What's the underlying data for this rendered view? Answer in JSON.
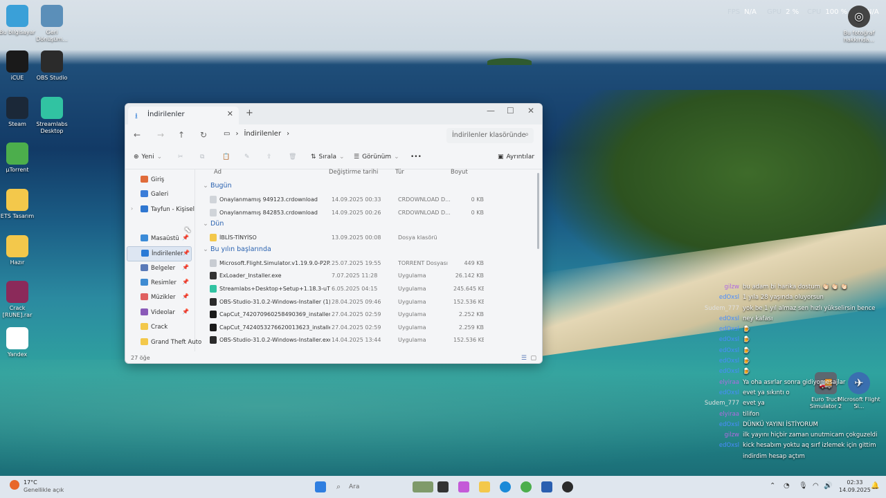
{
  "desktop": {
    "icons_left": [
      {
        "label": "Bu bilgisayar",
        "icon": "computer-icon",
        "color": "#3aa0d8"
      },
      {
        "label": "Geri Dönüşüm...",
        "icon": "recycle-bin-icon",
        "color": "#5b8fb9"
      },
      {
        "label": "iCUE",
        "icon": "icue-icon",
        "color": "#1a1a1a"
      },
      {
        "label": "OBS Studio",
        "icon": "obs-icon",
        "color": "#2b2b2b"
      },
      {
        "label": "Steam",
        "icon": "steam-icon",
        "color": "#1b2838"
      },
      {
        "label": "Streamlabs Desktop",
        "icon": "streamlabs-icon",
        "color": "#31c3a2"
      },
      {
        "label": "µTorrent",
        "icon": "utorrent-icon",
        "color": "#4cae4c"
      },
      {
        "label": "ETS Tasarım",
        "icon": "folder-icon",
        "color": "#f3c84b"
      },
      {
        "label": "Hazır",
        "icon": "folder-icon",
        "color": "#f3c84b"
      },
      {
        "label": "Crack [RUNE].rar",
        "icon": "winrar-icon",
        "color": "#8b2a5a"
      },
      {
        "label": "Yandex",
        "icon": "yandex-icon",
        "color": "#ffffff"
      }
    ],
    "icons_right": [
      {
        "label": "Bu fotoğraf hakkında...",
        "icon": "camera-info-icon"
      },
      {
        "label": "Euro Truck Simulator 2",
        "icon": "ets2-icon"
      },
      {
        "label": "Microsoft Flight Si...",
        "icon": "flight-simulator-icon"
      }
    ],
    "overlay_stats": {
      "fps_label": "FPS",
      "fps_value": "N/A",
      "gpu_label": "GPU",
      "gpu_value": "2 %",
      "cpu_label": "CPU",
      "cpu_value": "100 %",
      "extra_value": "N/A"
    }
  },
  "explorer": {
    "tab_title": "İndirilenler",
    "breadcrumb": [
      "İndirilenler"
    ],
    "search_placeholder": "İndirilenler klasöründe",
    "commands": {
      "new": "Yeni",
      "sort": "Sırala",
      "view": "Görünüm",
      "more": "•••",
      "details": "Ayrıntılar"
    },
    "sidebar": [
      {
        "label": "Giriş",
        "icon": "home-icon",
        "color": "#e06b3a"
      },
      {
        "label": "Galeri",
        "icon": "gallery-icon",
        "color": "#3b7dd8"
      },
      {
        "label": "Tayfun - Kişisel",
        "icon": "onedrive-icon",
        "color": "#2f77d1"
      },
      {
        "label": "Masaüstü",
        "icon": "desktop-icon",
        "color": "#3b8bd8"
      },
      {
        "label": "İndirilenler",
        "icon": "downloads-icon",
        "color": "#2a7ad6"
      },
      {
        "label": "Belgeler",
        "icon": "documents-icon",
        "color": "#5a7ab8"
      },
      {
        "label": "Resimler",
        "icon": "pictures-icon",
        "color": "#3f8bd2"
      },
      {
        "label": "Müzikler",
        "icon": "music-icon",
        "color": "#e06060"
      },
      {
        "label": "Videolar",
        "icon": "videos-icon",
        "color": "#8a5ab8"
      },
      {
        "label": "Crack",
        "icon": "folder-icon",
        "color": "#f3c84b"
      },
      {
        "label": "Grand Theft Auto",
        "icon": "folder-icon",
        "color": "#f3c84b"
      }
    ],
    "columns": {
      "name": "Ad",
      "date": "Değiştirme tarihi",
      "type": "Tür",
      "size": "Boyut"
    },
    "groups": [
      {
        "title": "Bugün",
        "rows": [
          {
            "name": "Onaylanmamış 949123.crdownload",
            "date": "14.09.2025 00:33",
            "type": "CRDOWNLOAD D...",
            "size": "0 KB",
            "icon_color": "#d0d4d9"
          },
          {
            "name": "Onaylanmamış 842853.crdownload",
            "date": "14.09.2025 00:26",
            "type": "CRDOWNLOAD D...",
            "size": "0 KB",
            "icon_color": "#d0d4d9"
          }
        ]
      },
      {
        "title": "Dün",
        "rows": [
          {
            "name": "İBLİS-TİNYİSO",
            "date": "13.09.2025 00:08",
            "type": "Dosya klasörü",
            "size": "",
            "icon_color": "#f3c84b"
          }
        ]
      },
      {
        "title": "Bu yılın başlarında",
        "rows": [
          {
            "name": "Microsoft.Flight.Simulator.v1.19.9.0-P2P...",
            "date": "25.07.2025 19:55",
            "type": "TORRENT Dosyası",
            "size": "449 KB",
            "icon_color": "#c8ccd2"
          },
          {
            "name": "ExLoader_Installer.exe",
            "date": "7.07.2025 11:28",
            "type": "Uygulama",
            "size": "26.142 KB",
            "icon_color": "#333333"
          },
          {
            "name": "Streamlabs+Desktop+Setup+1.18.3-uTPE...",
            "date": "6.05.2025 04:15",
            "type": "Uygulama",
            "size": "245.645 KB",
            "icon_color": "#31c3a2"
          },
          {
            "name": "OBS-Studio-31.0.2-Windows-Installer (1)...",
            "date": "28.04.2025 09:46",
            "type": "Uygulama",
            "size": "152.536 KB",
            "icon_color": "#2b2b2b"
          },
          {
            "name": "CapCut_7420709602584903​69_installer.exe",
            "date": "27.04.2025 02:59",
            "type": "Uygulama",
            "size": "2.252 KB",
            "icon_color": "#1a1a1a"
          },
          {
            "name": "CapCut_7424053276620013623_installer.exe",
            "date": "27.04.2025 02:59",
            "type": "Uygulama",
            "size": "2.259 KB",
            "icon_color": "#1a1a1a"
          },
          {
            "name": "OBS-Studio-31.0.2-Windows-Installer.exe",
            "date": "14.04.2025 13:44",
            "type": "Uygulama",
            "size": "152.536 KB",
            "icon_color": "#2b2b2b"
          }
        ]
      }
    ],
    "status": "27 öğe"
  },
  "chat": [
    {
      "user": "gilzw",
      "color": "#b06ae0",
      "msg": "bu adam bi harika dostum 👏🏻 👏🏻 👏🏻"
    },
    {
      "user": "edOxsl",
      "color": "#4a8cff",
      "msg": "1 yıla 28 yaşında oluyorsun"
    },
    {
      "user": "Sudem_777",
      "color": "#e0e0e0",
      "msg": "yok be 1 yıl almaz sen hızlı yükselirsin bence"
    },
    {
      "user": "edOxsl",
      "color": "#4a8cff",
      "msg": "ney kafası"
    },
    {
      "user": "edOxsl",
      "color": "#4a8cff",
      "msg": "🍺"
    },
    {
      "user": "edOxsl",
      "color": "#4a8cff",
      "msg": "🍺"
    },
    {
      "user": "edOxsl",
      "color": "#4a8cff",
      "msg": "🍺"
    },
    {
      "user": "edOxsl",
      "color": "#4a8cff",
      "msg": "🍺"
    },
    {
      "user": "edOxsl",
      "color": "#4a8cff",
      "msg": "🍺"
    },
    {
      "user": "elyiraa",
      "color": "#b06ae0",
      "msg": "Ya oha asırlar sonra gidiyomesajlar"
    },
    {
      "user": "edOxsl",
      "color": "#4a8cff",
      "msg": "evet ya sıkıntı o"
    },
    {
      "user": "Sudem_777",
      "color": "#e0e0e0",
      "msg": "evet ya"
    },
    {
      "user": "elyiraa",
      "color": "#b06ae0",
      "msg": "tilifon"
    },
    {
      "user": "edOxsl",
      "color": "#4a8cff",
      "msg": "DÜNKÜ YAYINI İSTİYORUM"
    },
    {
      "user": "gilzw",
      "color": "#b06ae0",
      "msg": "ilk yayını hiçbir zaman unutmicam çokguzeldi"
    },
    {
      "user": "edOxsl",
      "color": "#4a8cff",
      "msg": "kick hesabım yoktu aq sırf izlemek için gittim"
    },
    {
      "user": "",
      "color": "#ffffff",
      "msg": "indirdim hesap açtım"
    }
  ],
  "taskbar": {
    "weather_temp": "17°C",
    "weather_desc": "Genellikle açık",
    "search_placeholder": "Ara",
    "time": "02:33",
    "date": "14.09.2025"
  }
}
